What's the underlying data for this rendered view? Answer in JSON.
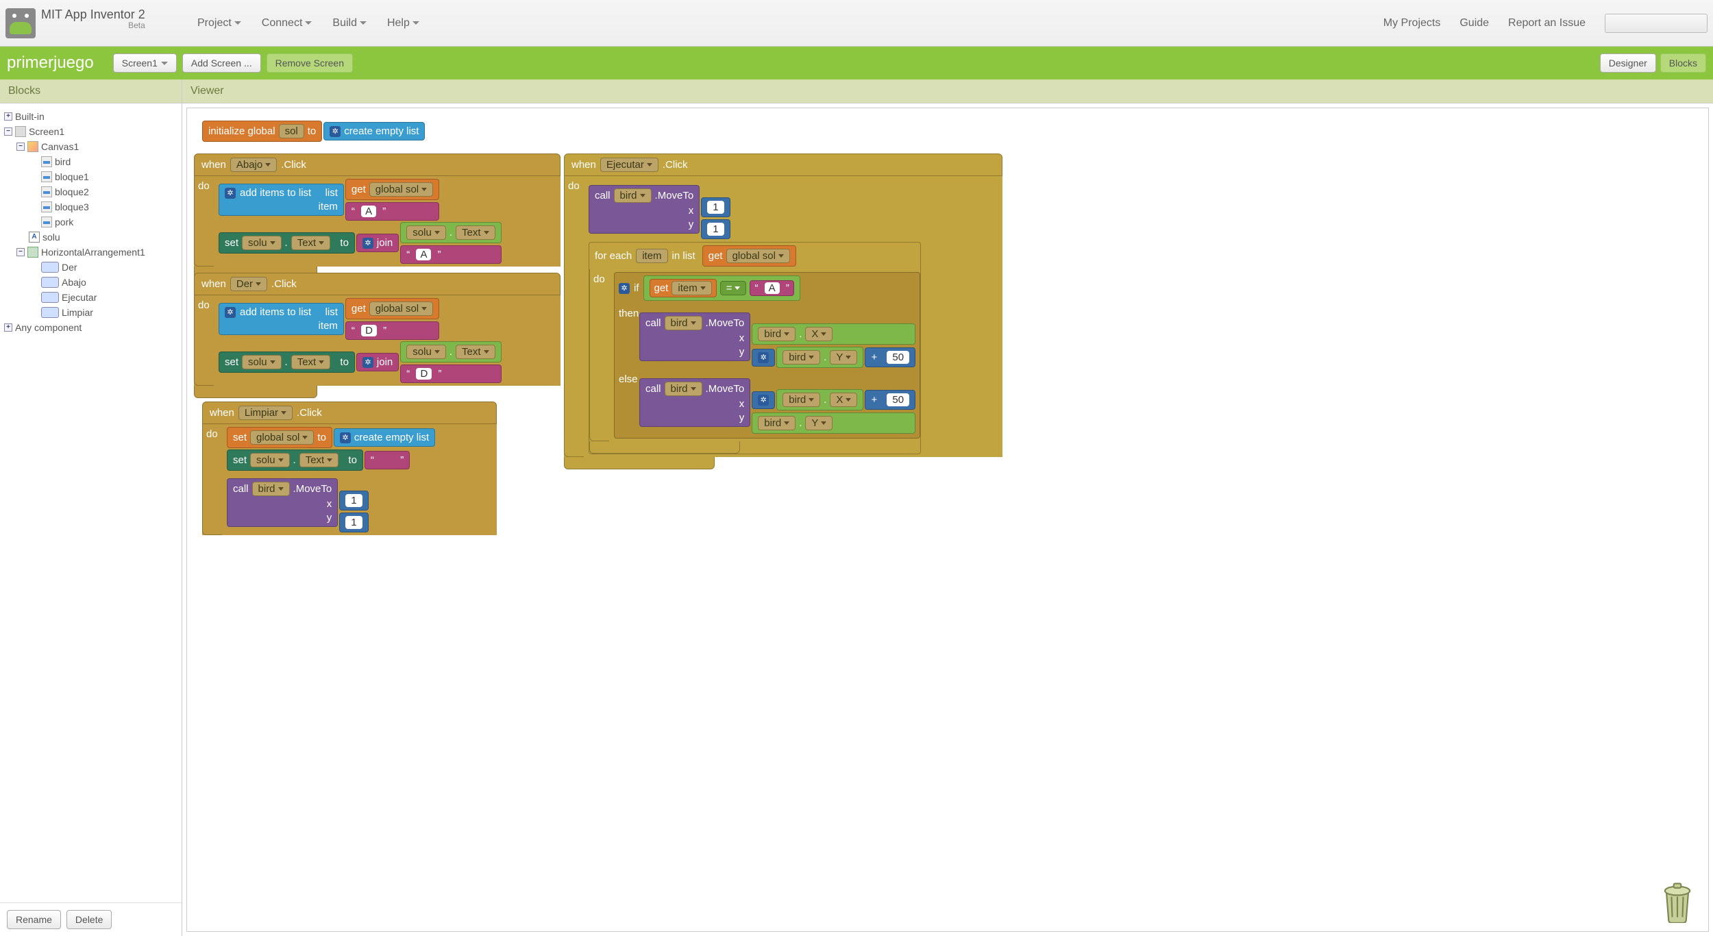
{
  "app": {
    "title": "MIT App Inventor 2",
    "beta": "Beta"
  },
  "menu": {
    "project": "Project",
    "connect": "Connect",
    "build": "Build",
    "help": "Help"
  },
  "rightMenu": {
    "myProjects": "My Projects",
    "guide": "Guide",
    "report": "Report an Issue"
  },
  "project": {
    "name": "primerjuego",
    "screenBtn": "Screen1",
    "addScreen": "Add Screen ...",
    "removeScreen": "Remove Screen",
    "designer": "Designer",
    "blocks": "Blocks"
  },
  "panels": {
    "blocks": "Blocks",
    "viewer": "Viewer"
  },
  "tree": {
    "builtin": "Built-in",
    "screen1": "Screen1",
    "canvas1": "Canvas1",
    "sprites": [
      "bird",
      "bloque1",
      "bloque2",
      "bloque3",
      "pork"
    ],
    "labelA": "A",
    "solu": "solu",
    "harr": "HorizontalArrangement1",
    "buttons": [
      "Der",
      "Abajo",
      "Ejecutar",
      "Limpiar"
    ],
    "anyComponent": "Any component",
    "rename": "Rename",
    "delete": "Delete"
  },
  "blocks": {
    "initGlobal": "initialize global",
    "sol": "sol",
    "to": "to",
    "createEmptyList": "create empty list",
    "when": "when",
    "click": ".Click",
    "do": "do",
    "addItems": "add items to list",
    "listLbl": "list",
    "itemLbl": "item",
    "get": "get",
    "globalSol": "global sol",
    "set": "set",
    "solu": "solu",
    "textProp": "Text",
    "join": "join",
    "txtA": "A",
    "txtD": "D",
    "abajo": "Abajo",
    "der": "Der",
    "limpiar": "Limpiar",
    "ejecutar": "Ejecutar",
    "call": "call",
    "bird": "bird",
    "moveTo": ".MoveTo",
    "x": "x",
    "y": "y",
    "one": "1",
    "fifty": "50",
    "forEach": "for each",
    "item": "item",
    "inList": "in list",
    "if": "if",
    "then": "then",
    "else": "else",
    "eq": "=",
    "dotX": "X",
    "dotY": "Y",
    "plus": "+",
    "quoteEmpty": "",
    "quoteA": "A",
    "quoteD": "D"
  }
}
